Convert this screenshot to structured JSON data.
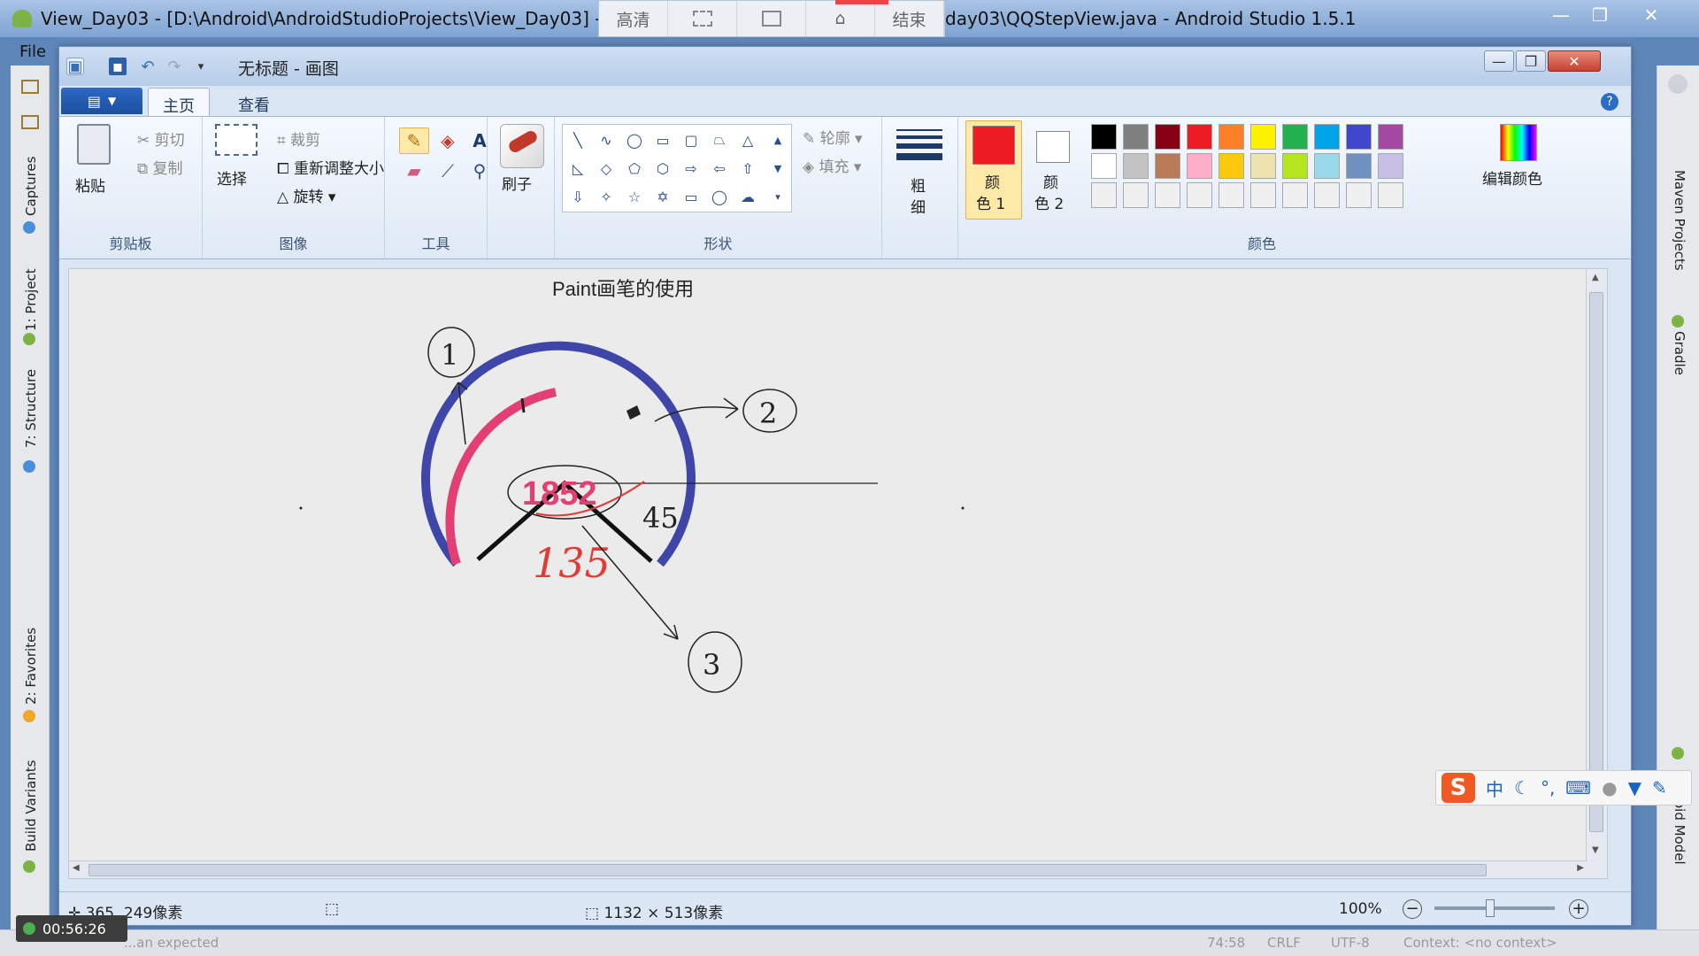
{
  "android_studio": {
    "title_left": "View_Day03 - [D:\\Android\\AndroidStudioProjects\\View_Day03] - [a",
    "title_right": "day03\\QQStepView.java - Android Studio 1.5.1",
    "menu_file": "File",
    "left_tabs": [
      "Captures",
      "1: Project",
      "7: Structure",
      "2: Favorites",
      "Build Variants"
    ],
    "right_tabs": [
      "Maven Projects",
      "Gradle",
      "oid Model"
    ],
    "status_bar": {
      "message": "...an expected",
      "position": "74:58",
      "line_sep": "CRLF",
      "encoding": "UTF-8",
      "context": "Context: <no context>"
    }
  },
  "recorder": {
    "buttons": [
      "高清",
      "",
      "",
      "",
      "结束"
    ],
    "timer": "00:56:26"
  },
  "paint": {
    "title": "无标题 - 画图",
    "tabs": [
      {
        "label": "主页",
        "active": true
      },
      {
        "label": "查看",
        "active": false
      }
    ],
    "clipboard": {
      "label": "剪贴板",
      "paste": "粘贴",
      "cut": "剪切",
      "copy": "复制"
    },
    "image": {
      "label": "图像",
      "select": "选择",
      "crop": "裁剪",
      "resize": "重新调整大小",
      "rotate": "旋转"
    },
    "tools": {
      "label": "工具"
    },
    "brushes": {
      "label": "刷子"
    },
    "shapes": {
      "label": "形状",
      "outline": "轮廓",
      "fill": "填充"
    },
    "size": {
      "label_line1": "粗",
      "label_line2": "细"
    },
    "colors": {
      "label": "颜色",
      "color1_line1": "颜",
      "color1_line2": "色 1",
      "color2_line1": "颜",
      "color2_line2": "色 2",
      "edit_colors": "编辑颜色",
      "color1_value": "#ed1c24",
      "color2_value": "#ffffff",
      "palette_row1": [
        "#000000",
        "#7f7f7f",
        "#880015",
        "#ed1c24",
        "#ff7f27",
        "#fff200",
        "#22b14c",
        "#00a2e8",
        "#3f48cc",
        "#a349a4"
      ],
      "palette_row2": [
        "#ffffff",
        "#c3c3c3",
        "#b97a57",
        "#ffaec9",
        "#ffc90e",
        "#efe4b0",
        "#b5e61d",
        "#99d9ea",
        "#7092be",
        "#c8bfe7"
      ]
    },
    "canvas": {
      "heading": "Paint画笔的使用",
      "number": "1852",
      "angle_45": "45",
      "angle_135": "135",
      "label_1": "1",
      "label_2": "2",
      "label_3": "3",
      "outer_color": "#3e47a8",
      "inner_color": "#e43f72"
    },
    "status": {
      "cursor_pos": "365, 249像素",
      "canvas_size": "1132 × 513像素",
      "zoom": "100%"
    }
  },
  "ime": {
    "mode": "中"
  }
}
